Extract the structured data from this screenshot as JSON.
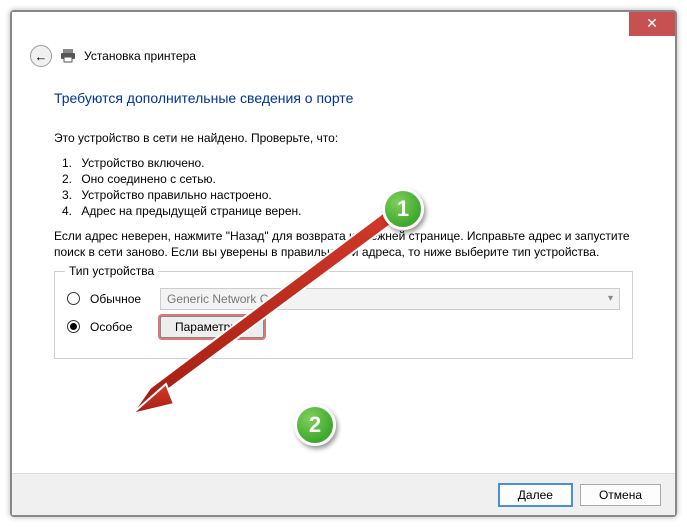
{
  "window": {
    "title": "Установка принтера"
  },
  "heading": "Требуются дополнительные сведения о порте",
  "intro": "Это устройство в сети не найдено. Проверьте, что:",
  "checks": [
    "Устройство включено.",
    "Оно соединено с сетью.",
    "Устройство правильно настроено.",
    "Адрес на предыдущей странице верен."
  ],
  "advice": "Если адрес неверен, нажмите \"Назад\" для возврата к прежней странице. Исправьте адрес и запустите поиск в сети заново. Если вы уверены в правильности адреса, то ниже выберите тип устройства.",
  "group": {
    "legend": "Тип устройства",
    "option_standard": "Обычное",
    "option_custom": "Особое",
    "combo_value": "Generic Network Card",
    "params_button": "Параметры..."
  },
  "footer": {
    "next": "Далее",
    "cancel": "Отмена"
  },
  "markers": {
    "one": "1",
    "two": "2"
  }
}
